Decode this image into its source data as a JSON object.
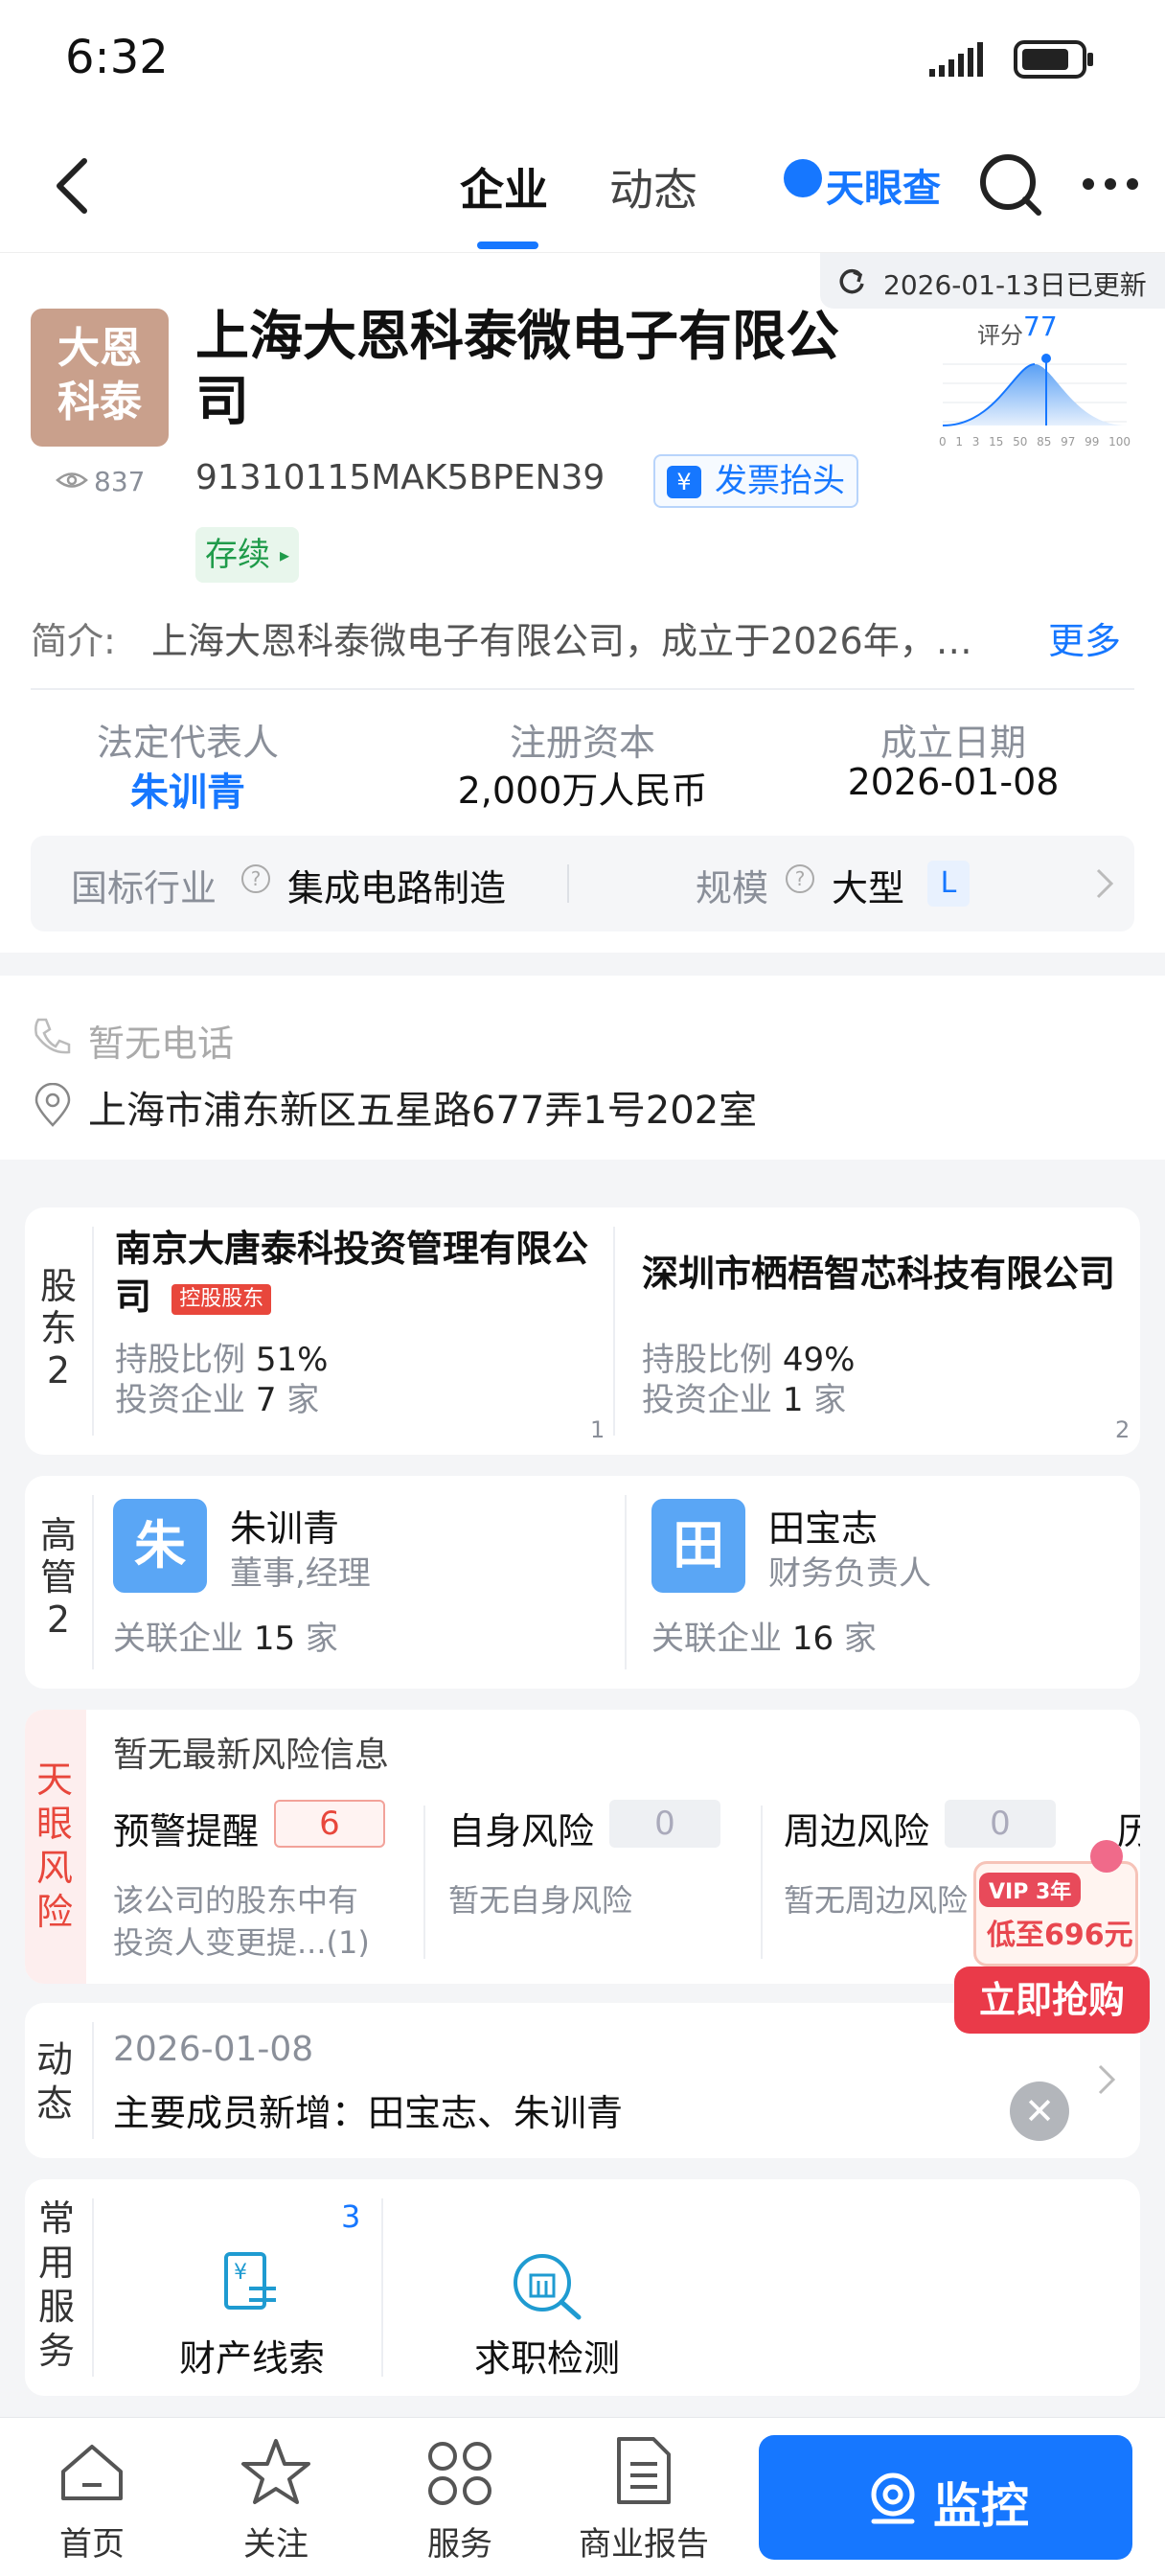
{
  "status_bar": {
    "time": "6:32"
  },
  "nav": {
    "tabs": [
      "企业",
      "动态"
    ],
    "brand": "天眼查"
  },
  "company": {
    "logo_text": "大恩科泰",
    "name": "上海大恩科泰微电子有限公司",
    "views": "837",
    "credit_code": "91310115MAK5BPEN39",
    "invoice_label": "发票抬头",
    "status": "存续",
    "update_text": "2026-01-13日已更新",
    "score_label": "评分",
    "score": "77",
    "score_ticks": [
      "0",
      "1",
      "3",
      "15",
      "50",
      "85",
      "97",
      "99",
      "100"
    ],
    "intro_label": "简介:",
    "intro_text": "上海大恩科泰微电子有限公司，成立于2026年，…",
    "more_label": "更多"
  },
  "basic_info": {
    "legal_rep_label": "法定代表人",
    "legal_rep": "朱训青",
    "capital_label": "注册资本",
    "capital": "2,000万人民币",
    "founded_label": "成立日期",
    "founded": "2026-01-08",
    "industry_label": "国标行业",
    "industry": "集成电路制造",
    "scale_label": "规模",
    "scale": "大型",
    "scale_badge": "L"
  },
  "contact": {
    "phone": "暂无电话",
    "address": "上海市浦东新区五星路677弄1号202室"
  },
  "shareholders": {
    "label": "股东",
    "count": "2",
    "items": [
      {
        "name_line1": "南京大唐泰科投资管理有限公",
        "name_line2": "司",
        "tag": "控股股东",
        "ratio_label": "持股比例",
        "ratio": "51%",
        "invest_label": "投资企业",
        "invest": "7",
        "unit": "家",
        "index": "1"
      },
      {
        "name_line1": "深圳市栖梧智芯科技有限公司",
        "name_line2": "",
        "tag": "",
        "ratio_label": "持股比例",
        "ratio": "49%",
        "invest_label": "投资企业",
        "invest": "1",
        "unit": "家",
        "index": "2"
      }
    ]
  },
  "executives": {
    "label": "高管",
    "count": "2",
    "items": [
      {
        "avatar": "朱",
        "name": "朱训青",
        "role": "董事,经理",
        "related_label": "关联企业",
        "related": "15",
        "unit": "家"
      },
      {
        "avatar": "田",
        "name": "田宝志",
        "role": "财务负责人",
        "related_label": "关联企业",
        "related": "16",
        "unit": "家"
      }
    ]
  },
  "risk": {
    "label": "天眼风险",
    "headline": "暂无最新风险信息",
    "items": [
      {
        "title": "预警提醒",
        "count": "6",
        "desc1": "该公司的股东中有",
        "desc2": "投资人变更提...(1)"
      },
      {
        "title": "自身风险",
        "count": "0",
        "desc1": "暂无自身风险",
        "desc2": ""
      },
      {
        "title": "周边风险",
        "count": "0",
        "desc1": "暂无周边风险",
        "desc2": ""
      },
      {
        "title": "历",
        "count": "",
        "desc1": "",
        "desc2": ""
      }
    ]
  },
  "promo": {
    "vip": "VIP 3年",
    "price": "低至696元",
    "cta": "立即抢购"
  },
  "news": {
    "label": "动态",
    "date": "2026-01-08",
    "text": "主要成员新增：田宝志、朱训青"
  },
  "services": {
    "label": "常用服务",
    "items": [
      {
        "label": "财产线索",
        "badge": "3"
      },
      {
        "label": "求职检测",
        "badge": ""
      }
    ]
  },
  "bottom_nav": {
    "items": [
      "首页",
      "关注",
      "服务",
      "商业报告"
    ],
    "monitor": "监控"
  },
  "colors": {
    "brand_blue": "#1677ff",
    "risk_red": "#e8473c",
    "logo_bg": "#c9a08c"
  }
}
